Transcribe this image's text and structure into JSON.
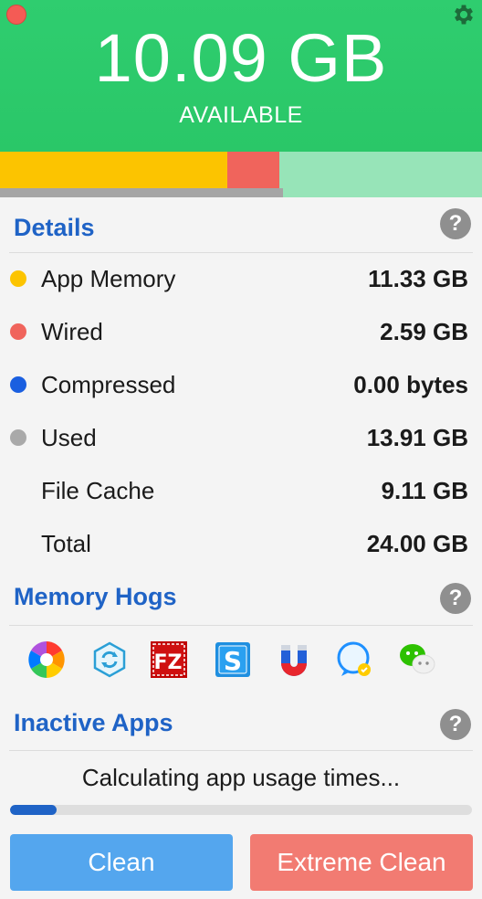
{
  "header": {
    "available_value": "10.09 GB",
    "available_label": "AVAILABLE",
    "background": "#2ecc71"
  },
  "usage_bar": {
    "app_memory_fraction": 0.472,
    "wired_fraction": 0.108,
    "colors": {
      "app_memory": "#fcc400",
      "wired": "#f0645c",
      "free": "#97e4b8"
    }
  },
  "details": {
    "title": "Details",
    "help": "?",
    "rows": [
      {
        "label": "App Memory",
        "value": "11.33 GB",
        "dot": "#fcc400"
      },
      {
        "label": "Wired",
        "value": "2.59 GB",
        "dot": "#f0645c"
      },
      {
        "label": "Compressed",
        "value": "0.00 bytes",
        "dot": "#1a5fe0"
      },
      {
        "label": "Used",
        "value": "13.91 GB",
        "dot": "#a9a9a9"
      },
      {
        "label": "File Cache",
        "value": "9.11 GB",
        "dot": ""
      },
      {
        "label": "Total",
        "value": "24.00 GB",
        "dot": ""
      }
    ]
  },
  "memory_hogs": {
    "title": "Memory Hogs",
    "help": "?",
    "apps": [
      "rainbow-pinwheel-icon",
      "sync-cube-icon",
      "filezilla-icon",
      "s-app-icon",
      "magnet-icon",
      "chat-bubble-icon",
      "wechat-icon"
    ]
  },
  "inactive_apps": {
    "title": "Inactive Apps",
    "help": "?",
    "status": "Calculating app usage times...",
    "progress": 0.1
  },
  "buttons": {
    "clean": "Clean",
    "extreme_clean": "Extreme Clean"
  }
}
